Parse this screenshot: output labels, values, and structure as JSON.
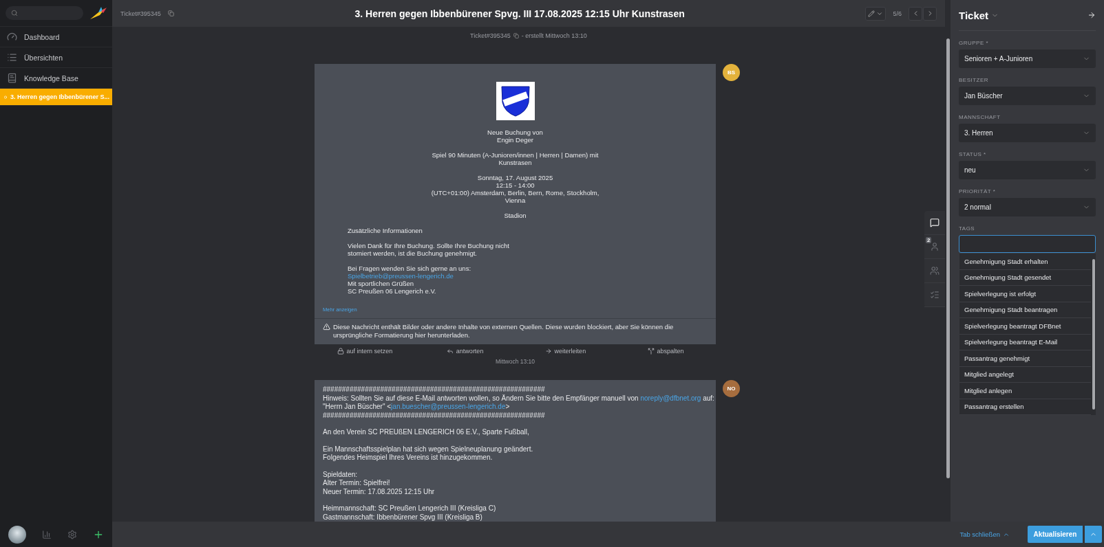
{
  "sidebar": {
    "nav": [
      {
        "kind": "dashboard",
        "label": "Dashboard",
        "selected": false
      },
      {
        "kind": "overviews",
        "label": "Übersichten",
        "selected": false
      },
      {
        "kind": "knowledge",
        "label": "Knowledge Base",
        "selected": false
      },
      {
        "kind": "ticket",
        "label": "3. Herren gegen Ibbenbürener S...",
        "selected": true
      }
    ],
    "footer": [
      {
        "kind": "avatar"
      },
      {
        "kind": "stats"
      },
      {
        "kind": "settings"
      },
      {
        "kind": "new"
      }
    ]
  },
  "header": {
    "ticket_number": "Ticket#395345",
    "title": "3. Herren gegen Ibbenbürener Spvg. III 17.08.2025 12:15 Uhr Kunstrasen",
    "pager": "5/6"
  },
  "meta": {
    "ticket_number": "Ticket#395345",
    "created": "- erstellt Mittwoch 13:10"
  },
  "articles": [
    {
      "kind": "booking",
      "avatar": "BS",
      "color": "#e3b23c",
      "paragraphs": [
        {
          "kind": "centered",
          "lines": [
            [
              {
                "kind": "text",
                "text": "Neue Buchung von"
              }
            ],
            [
              {
                "kind": "text",
                "text": "Engin Deger"
              }
            ]
          ]
        },
        {
          "kind": "centered",
          "lines": [
            [
              {
                "kind": "text",
                "text": "Spiel 90 Minuten (A-Junioren/innen | Herren | Damen) mit"
              }
            ],
            [
              {
                "kind": "text",
                "text": "Kunstrasen"
              }
            ]
          ]
        },
        {
          "kind": "centered",
          "lines": [
            [
              {
                "kind": "text",
                "text": "Sonntag, 17. August 2025"
              }
            ],
            [
              {
                "kind": "text",
                "text": "12:15 - 14:00"
              }
            ],
            [
              {
                "kind": "text",
                "text": "(UTC+01:00) Amsterdam, Berlin, Bern, Rome, Stockholm,"
              }
            ],
            [
              {
                "kind": "text",
                "text": "Vienna"
              }
            ]
          ]
        },
        {
          "kind": "centered",
          "lines": [
            [
              {
                "kind": "text",
                "text": "Stadion"
              }
            ]
          ]
        },
        {
          "kind": "indented",
          "lines": [
            [
              {
                "kind": "text",
                "text": "Zusätzliche Informationen"
              }
            ]
          ]
        },
        {
          "kind": "indented",
          "lines": [
            [
              {
                "kind": "text",
                "text": "Vielen Dank für Ihre Buchung. Sollte Ihre Buchung nicht"
              }
            ],
            [
              {
                "kind": "text",
                "text": "storniert werden, ist die Buchung genehmigt."
              }
            ]
          ]
        },
        {
          "kind": "indented",
          "lines": [
            [
              {
                "kind": "text",
                "text": "Bei Fragen wenden Sie sich gerne an uns:"
              }
            ],
            [
              {
                "kind": "link",
                "text": "Spielbetrieb@preussen-lengerich.de"
              }
            ],
            [
              {
                "kind": "text",
                "text": "Mit sportlichen Grüßen"
              }
            ],
            [
              {
                "kind": "text",
                "text": "SC Preußen 06 Lengerich e.V."
              }
            ]
          ]
        }
      ],
      "more": "Mehr anzeigen",
      "notice": "Diese Nachricht enthält Bilder oder andere Inhalte von externen Quellen. Diese wurden blockiert, aber Sie können die ursprüngliche Formatierung hier herunterladen.",
      "actions": [
        {
          "kind": "lock",
          "label": "auf intern setzen"
        },
        {
          "kind": "reply",
          "label": "antworten"
        },
        {
          "kind": "forward",
          "label": "weiterleiten"
        },
        {
          "kind": "split",
          "label": "abspalten"
        }
      ],
      "timestamp": "Mittwoch 13:10"
    },
    {
      "kind": "plain",
      "avatar": "NO",
      "color": "#a66d3e",
      "paragraphs": [
        {
          "kind": "left",
          "lines": [
            [
              {
                "kind": "text",
                "text": "##########################################################"
              }
            ],
            [
              {
                "kind": "text",
                "text": "Hinweis: Sollten Sie auf diese E-Mail antworten wollen, so Ändern Sie bitte den Empfänger manuell von "
              },
              {
                "kind": "link",
                "text": "noreply@dfbnet.org"
              },
              {
                "kind": "text",
                "text": " auf:"
              }
            ],
            [
              {
                "kind": "text",
                "text": "\"Herrn Jan Büscher\" <"
              },
              {
                "kind": "link",
                "text": "jan.buescher@preussen-lengerich.de"
              },
              {
                "kind": "text",
                "text": ">"
              }
            ],
            [
              {
                "kind": "text",
                "text": "##########################################################"
              }
            ]
          ]
        },
        {
          "kind": "left",
          "lines": [
            [
              {
                "kind": "text",
                "text": "An den Verein SC PREUßEN LENGERICH 06 E.V., Sparte Fußball,"
              }
            ]
          ]
        },
        {
          "kind": "left",
          "lines": [
            [
              {
                "kind": "text",
                "text": "Ein Mannschaftsspielplan hat sich wegen Spielneuplanung geändert."
              }
            ],
            [
              {
                "kind": "text",
                "text": "Folgendes Heimspiel Ihres Vereins ist hinzugekommen."
              }
            ]
          ]
        },
        {
          "kind": "left",
          "lines": [
            [
              {
                "kind": "text",
                "text": "Spieldaten:"
              }
            ],
            [
              {
                "kind": "text",
                "text": "Alter Termin: Spielfrei!"
              }
            ],
            [
              {
                "kind": "text",
                "text": "Neuer Termin: 17.08.2025 12:15 Uhr"
              }
            ]
          ]
        },
        {
          "kind": "left",
          "lines": [
            [
              {
                "kind": "text",
                "text": "Heimmannschaft: SC Preußen Lengerich III (Kreisliga C)"
              }
            ],
            [
              {
                "kind": "text",
                "text": "Gastmannschaft: Ibbenbürener Spvg III (Kreisliga B)"
              }
            ]
          ]
        }
      ]
    }
  ],
  "rail": [
    {
      "kind": "chat",
      "selected": true
    },
    {
      "kind": "customer",
      "selected": false,
      "badge": "2"
    },
    {
      "kind": "organization",
      "selected": false
    },
    {
      "kind": "checklist",
      "selected": false
    }
  ],
  "panel": {
    "title": "Ticket",
    "fields": [
      {
        "label": "GRUPPE *",
        "value": "Senioren + A-Junioren"
      },
      {
        "label": "BESITZER",
        "value": "Jan Büscher"
      },
      {
        "label": "MANNSCHAFT",
        "value": "3. Herren"
      },
      {
        "label": "STATUS *",
        "value": "neu"
      },
      {
        "label": "PRIORITÄT *",
        "value": "2 normal"
      }
    ],
    "tags": {
      "label": "TAGS",
      "suggestions": [
        "Genehmigung Stadt erhalten",
        "Genehmigung Stadt gesendet",
        "Spielverlegung ist erfolgt",
        "Genehmigung Stadt beantragen",
        "Spielverlegung beantragt DFBnet",
        "Spielverlegung beantragt E-Mail",
        "Passantrag genehmigt",
        "Mitglied angelegt",
        "Mitglied anlegen",
        "Passantrag erstellen"
      ]
    }
  },
  "footer": {
    "close_tab": "Tab schließen",
    "submit": "Aktualisieren"
  }
}
